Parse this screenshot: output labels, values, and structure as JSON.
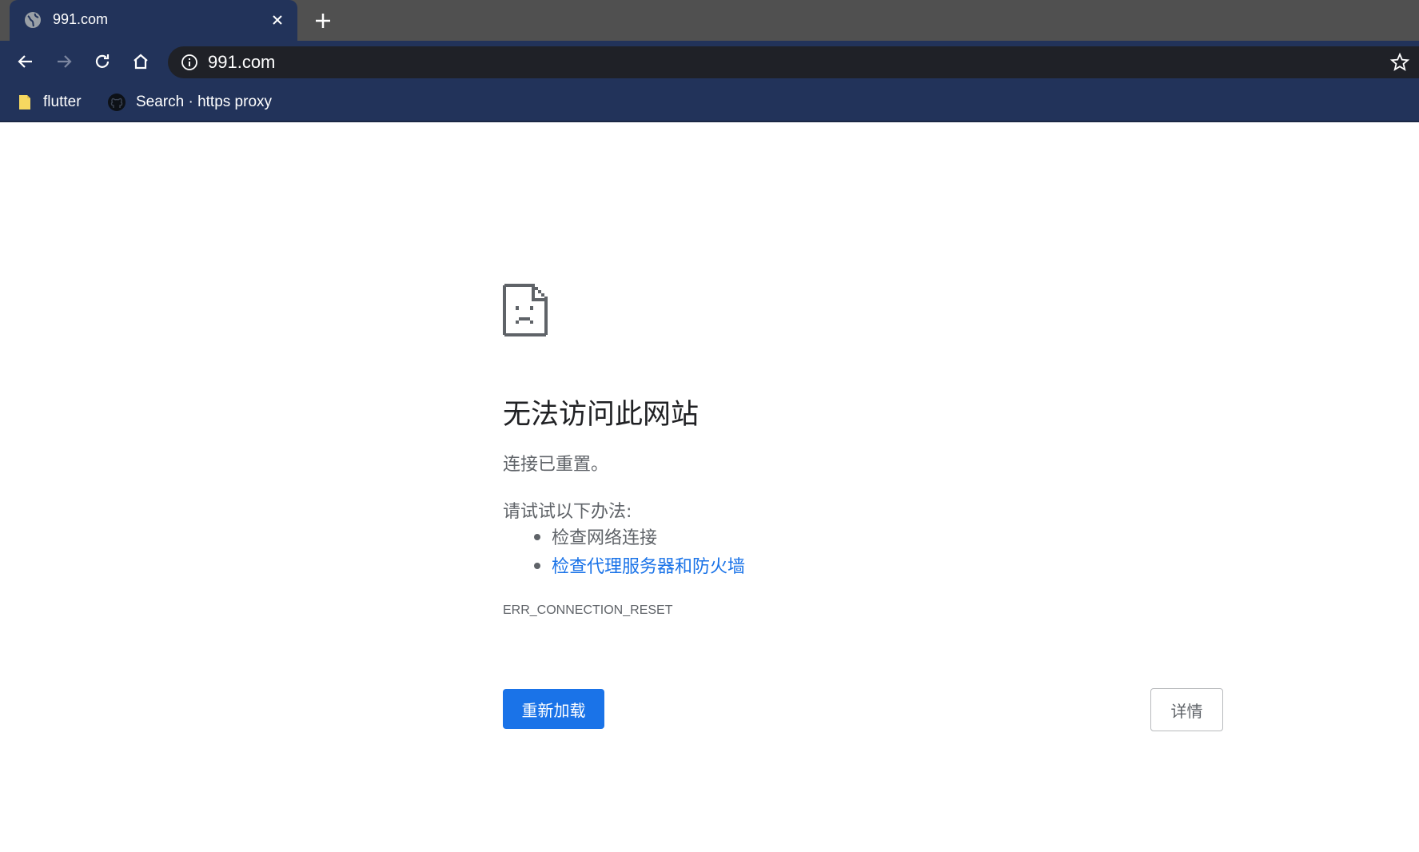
{
  "browser": {
    "tab": {
      "title": "991.com",
      "favicon": "globe-icon"
    },
    "toolbar": {
      "back_icon": "back-arrow-icon",
      "forward_icon": "forward-arrow-icon",
      "reload_icon": "reload-icon",
      "home_icon": "home-icon",
      "url": "991.com",
      "info_icon": "info-icon",
      "bookmark_star_icon": "star-icon"
    },
    "bookmarks": [
      {
        "label": "flutter",
        "icon": "folder-icon"
      },
      {
        "label": "Search · https proxy",
        "icon": "github-icon"
      }
    ],
    "colors": {
      "tabstrip": "#505050",
      "toolbar": "#22335a",
      "omnibox": "#1f2127"
    }
  },
  "error_page": {
    "icon": "sad-page-icon",
    "heading": "无法访问此网站",
    "subtitle": "连接已重置。",
    "try_label": "请试试以下办法:",
    "suggestions": [
      {
        "text": "检查网络连接",
        "is_link": false
      },
      {
        "text": "检查代理服务器和防火墙",
        "is_link": true
      }
    ],
    "error_code": "ERR_CONNECTION_RESET",
    "reload_button": "重新加载",
    "details_button": "详情",
    "colors": {
      "primary": "#1a73e8",
      "text": "#5f6368",
      "heading": "#202124"
    }
  }
}
